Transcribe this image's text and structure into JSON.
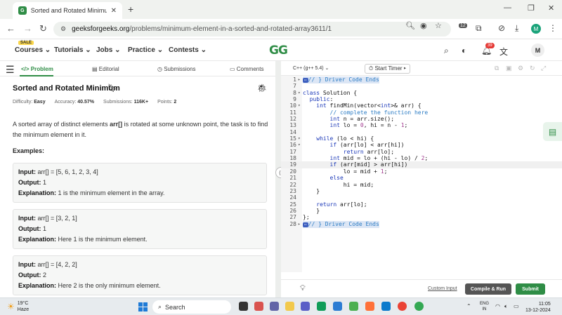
{
  "browser": {
    "tab_title": "Sorted and Rotated Minimum |",
    "new_tab": "+",
    "url_domain": "geeksforgeeks.org",
    "url_path": "/problems/minimum-element-in-a-sorted-and-rotated-array3611/1",
    "profile_initial": "M",
    "ext_badge": "12"
  },
  "gfg_header": {
    "sale": "SALE",
    "menus": [
      "Courses",
      "Tutorials",
      "Jobs",
      "Practice",
      "Contests"
    ],
    "logo": "GG",
    "notif_count": "39",
    "avatar": "M"
  },
  "left_tabs": {
    "problem": "Problem",
    "editorial": "Editorial",
    "submissions": "Submissions",
    "comments": "Comments"
  },
  "problem": {
    "title": "Sorted and Rotated Minimum",
    "difficulty_label": "Difficulty:",
    "difficulty": "Easy",
    "accuracy_label": "Accuracy:",
    "accuracy": "40.57%",
    "submissions_label": "Submissions:",
    "submissions": "116K+",
    "points_label": "Points:",
    "points": "2",
    "desc_pre": "A sorted array of distinct elements ",
    "desc_arr": "arr[]",
    "desc_post": " is rotated at some unknown point, the task is to find the minimum element in it.",
    "examples_heading": "Examples:",
    "examples": [
      {
        "input": "arr[] = [5, 6, 1, 2, 3, 4]",
        "output": "1",
        "explanation": "1 is the minimum element in the array."
      },
      {
        "input": "arr[] = [3, 2, 1]",
        "output": "1",
        "explanation": "Here 1 is the minimum element."
      },
      {
        "input": "arr[] = [4, 2, 2]",
        "output": "2",
        "explanation": "Here 2 is the only minimum element."
      }
    ],
    "input_label": "Input:",
    "output_label": "Output:",
    "explanation_label": "Explanation:"
  },
  "editor": {
    "language": "C++ (g++ 5.4)",
    "start_timer": "Start Timer",
    "custom_input": "Custom Input",
    "compile_run": "Compile & Run",
    "submit": "Submit"
  },
  "taskbar": {
    "temp": "19°C",
    "weather": "Haze",
    "search": "Search",
    "lang1": "ENG",
    "lang2": "IN",
    "time": "11:05",
    "date": "13-12-2024"
  }
}
